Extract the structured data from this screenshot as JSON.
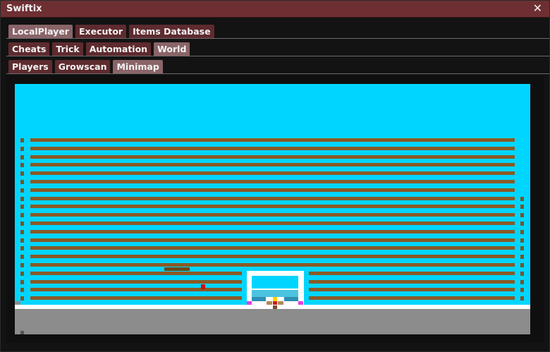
{
  "window": {
    "title": "Swiftix",
    "close_glyph": "✕"
  },
  "tabs_row1": [
    {
      "label": "LocalPlayer",
      "active": true
    },
    {
      "label": "Executor",
      "active": false
    },
    {
      "label": "Items Database",
      "active": false
    }
  ],
  "tabs_row2": [
    {
      "label": "Cheats",
      "active": false
    },
    {
      "label": "Trick",
      "active": false
    },
    {
      "label": "Automation",
      "active": false
    },
    {
      "label": "World",
      "active": true
    }
  ],
  "tabs_row3": [
    {
      "label": "Players",
      "active": false
    },
    {
      "label": "Growscan",
      "active": false
    },
    {
      "label": "Minimap",
      "active": true
    }
  ],
  "minimap": {
    "sky_color": "#00d5ff",
    "dirt_color": "#8a5a26",
    "bedrock_color": "#8c8c8c",
    "ground_line_color": "#ffffff",
    "door_color": "#ffffff",
    "player_color": "#cc1111"
  }
}
